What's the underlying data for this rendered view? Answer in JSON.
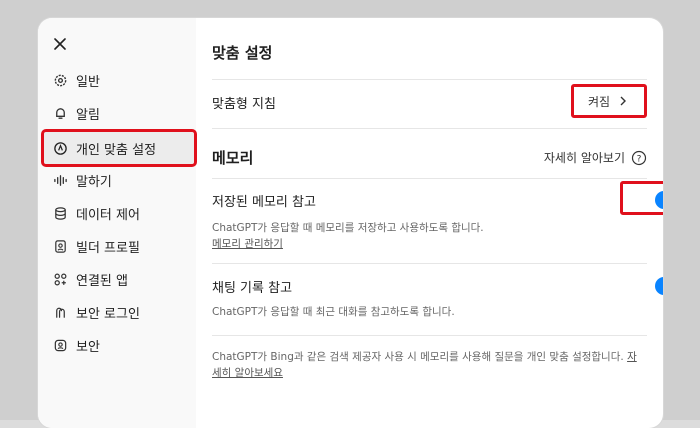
{
  "sidebar": {
    "items": [
      {
        "label": "일반",
        "icon": "gear-icon"
      },
      {
        "label": "알림",
        "icon": "bell-icon"
      },
      {
        "label": "개인 맞춤 설정",
        "icon": "personalize-icon"
      },
      {
        "label": "말하기",
        "icon": "voice-wave-icon"
      },
      {
        "label": "데이터 제어",
        "icon": "database-icon"
      },
      {
        "label": "빌더 프로필",
        "icon": "profile-card-icon"
      },
      {
        "label": "연결된 앱",
        "icon": "apps-icon"
      },
      {
        "label": "보안 로그인",
        "icon": "secure-login-icon"
      },
      {
        "label": "보안",
        "icon": "security-icon"
      }
    ],
    "active": "개인 맞춤 설정"
  },
  "main": {
    "title": "맞춤 설정",
    "custom_instructions": {
      "label": "맞춤형 지침",
      "value": "켜짐"
    },
    "memory": {
      "title": "메모리",
      "learn_more": "자세히 알아보기",
      "saved_memory": {
        "label": "저장된 메모리 참고",
        "description": "ChatGPT가 응답할 때 메모리를 저장하고 사용하도록 합니다.",
        "manage_link": "메모리 관리하기",
        "enabled": true
      },
      "chat_history": {
        "label": "채팅 기록 참고",
        "description": "ChatGPT가 응답할 때 최근 대화를 참고하도록 합니다.",
        "enabled": true
      },
      "footer_text": "ChatGPT가 Bing과 같은 검색 제공자 사용 시 메모리를 사용해 질문을 개인 맞춤 설정합니다.",
      "footer_link": "자세히 알아보세요"
    }
  },
  "colors": {
    "accent": "#0a84ff",
    "highlight": "#e0101c"
  }
}
